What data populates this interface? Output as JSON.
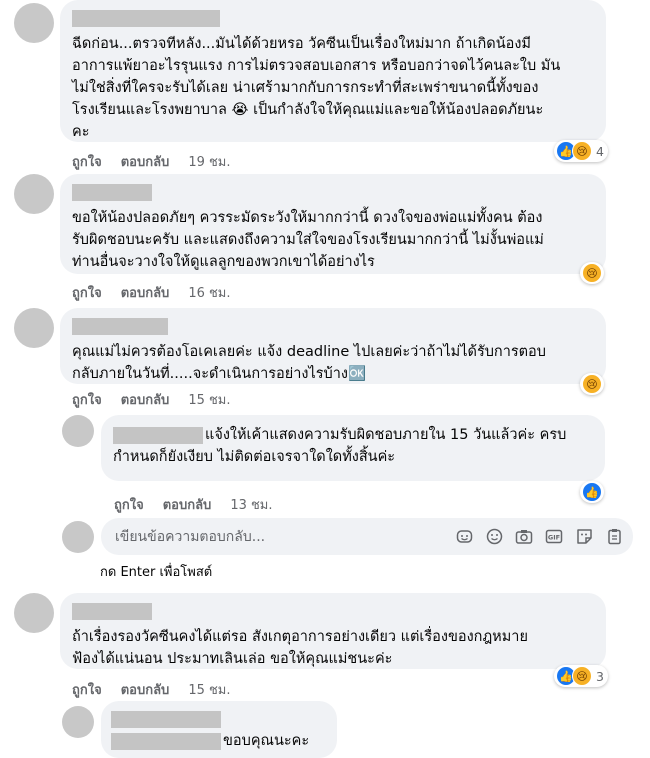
{
  "actions": {
    "like": "ถูกใจ",
    "reply": "ตอบกลับ"
  },
  "comments": [
    {
      "text": "ฉีดก่อน...ตรวจทีหลัง...มันได้ด้วยหรอ วัคซีนเป็นเรื่องใหม่มาก ถ้าเกิดน้องมี\nอาการแพ้ยาอะไรรุนแรง การไม่ตรวจสอบเอกสาร หรือบอกว่าจดไว้คนละใบ มัน\nไม่ใช่สิ่งที่ใครจะรับได้เลย น่าเศร้ามากกับการกระทำที่สะเพร่าขนาดนี้ทั้งของ\nโรงเรียนและโรงพยาบาล 😭 เป็นกำลังใจให้คุณแม่และขอให้น้องปลอดภัยนะ\nคะ",
      "time": "19 ชม.",
      "reaction_count": "4"
    },
    {
      "text": "ขอให้น้องปลอดภัยๆ ควรระมัดระวังให้มากกว่านี้ ดวงใจของพ่อแม่ทั้งคน ต้อง\nรับผิดชอบนะครับ และแสดงถึงความใส่ใจของโรงเรียนมากกว่านี้ ไม่งั้นพ่อแม่\nท่านอื่นจะวางใจให้ดูแลลูกของพวกเขาได้อย่างไร",
      "time": "16 ชม."
    },
    {
      "text": "คุณแม่ไม่ควรต้องโอเคเลยค่ะ แจ้ง deadline ไปเลยค่ะว่าถ้าไม่ได้รับการตอบ\nกลับภายในวันที่.....จะดำเนินการอย่างไรบ้าง🆗",
      "time": "15 ชม."
    },
    {
      "text": "ถ้าเรื่องรองวัคซีนคงได้แต่รอ สังเกตุอาการอย่างเดียว แต่เรื่องของกฎหมาย\nฟ้องได้แน่นอน ประมาทเลินเล่อ ขอให้คุณแม่ชนะค่ะ",
      "time": "15 ชม.",
      "reaction_count": "3"
    }
  ],
  "replies": [
    {
      "text_line1": "แจ้งให้เค้าแสดงความรับผิดชอบภายใน 15 วันแล้วค่ะ ครบ",
      "text_line2": "กำหนดก็ยังเงียบ ไม่ติดต่อเจรจาใดใดทั้งสิ้นค่ะ",
      "time": "13 ชม."
    },
    {
      "text": "ขอบคุณนะคะ"
    }
  ],
  "reply_box": {
    "placeholder": "เขียนข้อความตอบกลับ...",
    "hint": "กด Enter เพื่อโพสต์",
    "tools": [
      "sticker-icon",
      "emoji-icon",
      "camera-icon",
      "gif-icon",
      "sticker-pack-icon",
      "clipboard-icon"
    ]
  }
}
